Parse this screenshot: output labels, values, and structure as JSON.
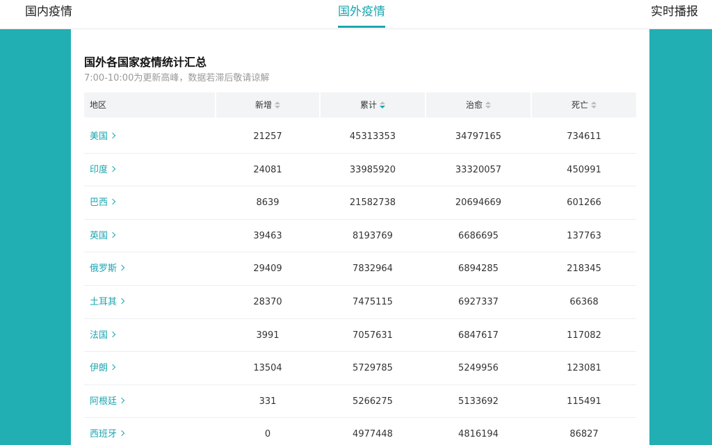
{
  "topnav": {
    "tabs": [
      {
        "label": "国内疫情"
      },
      {
        "label": "国外疫情"
      },
      {
        "label": "实时播报"
      }
    ]
  },
  "panel": {
    "title": "国外各国家疫情统计汇总",
    "subtitle": "7:00-10:00为更新高峰，数据若滞后敬请谅解"
  },
  "table": {
    "headers": [
      "地区",
      "新增",
      "累计",
      "治愈",
      "死亡"
    ],
    "rows": [
      [
        "美国",
        "21257",
        "45313353",
        "34797165",
        "734611"
      ],
      [
        "印度",
        "24081",
        "33985920",
        "33320057",
        "450991"
      ],
      [
        "巴西",
        "8639",
        "21582738",
        "20694669",
        "601266"
      ],
      [
        "英国",
        "39463",
        "8193769",
        "6686695",
        "137763"
      ],
      [
        "俄罗斯",
        "29409",
        "7832964",
        "6894285",
        "218345"
      ],
      [
        "土耳其",
        "28370",
        "7475115",
        "6927337",
        "66368"
      ],
      [
        "法国",
        "3991",
        "7057631",
        "6847617",
        "117082"
      ],
      [
        "伊朗",
        "13504",
        "5729785",
        "5249956",
        "123081"
      ],
      [
        "阿根廷",
        "331",
        "5266275",
        "5133692",
        "115491"
      ],
      [
        "西班牙",
        "0",
        "4977448",
        "4816194",
        "86827"
      ]
    ]
  },
  "colors": {
    "accent": "#1aa6b0",
    "background": "#22afb4"
  },
  "icons": {
    "sort": "sort-icon",
    "chevron": "chevron-right-icon"
  }
}
